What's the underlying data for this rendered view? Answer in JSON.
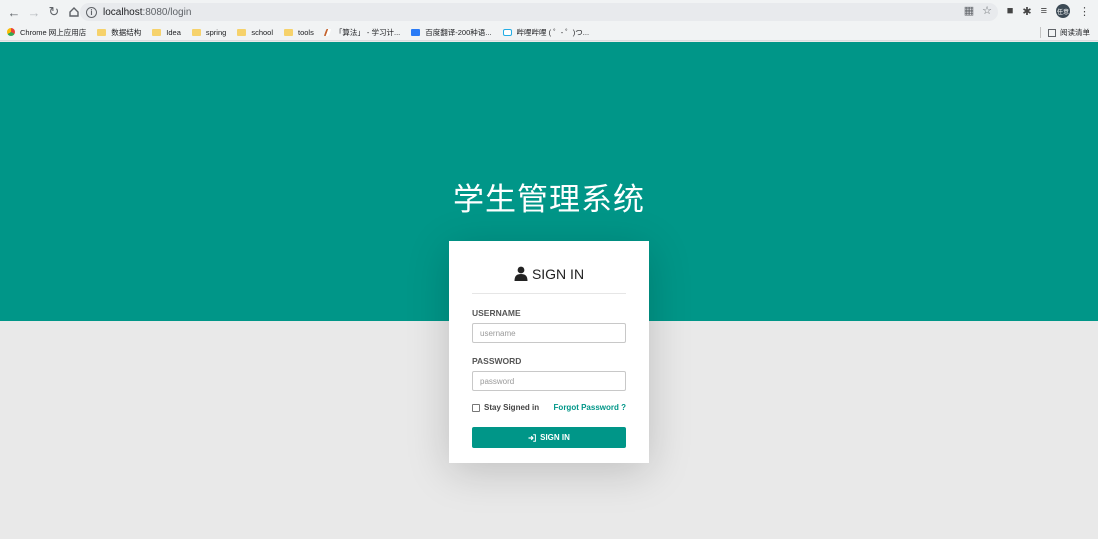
{
  "browser": {
    "url_host": "localhost",
    "url_rest": ":8080/login",
    "avatar_text": "任意",
    "bookmarks": [
      {
        "label": "Chrome 网上应用店",
        "icon": "apps-icon"
      },
      {
        "label": "数据结构",
        "icon": "folder-icon"
      },
      {
        "label": "Idea",
        "icon": "folder-icon"
      },
      {
        "label": "spring",
        "icon": "folder-icon"
      },
      {
        "label": "school",
        "icon": "folder-icon"
      },
      {
        "label": "tools",
        "icon": "folder-icon"
      },
      {
        "label": "「算法」 - 学习计...",
        "icon": "algo-icon"
      },
      {
        "label": "百度翻译-200种语...",
        "icon": "translate-icon"
      },
      {
        "label": "哔哩哔哩 ( ゜- ゜)つ...",
        "icon": "bilibili-icon"
      }
    ],
    "reading_list_label": "阅读清单"
  },
  "page": {
    "title": "学生管理系统",
    "accent_color": "#009688"
  },
  "login": {
    "heading": "SIGN IN",
    "username_label": "USERNAME",
    "username_placeholder": "username",
    "password_label": "PASSWORD",
    "password_placeholder": "password",
    "stay_signed_in": "Stay Signed in",
    "forgot_password": "Forgot Password ?",
    "submit_label": "SIGN IN"
  }
}
